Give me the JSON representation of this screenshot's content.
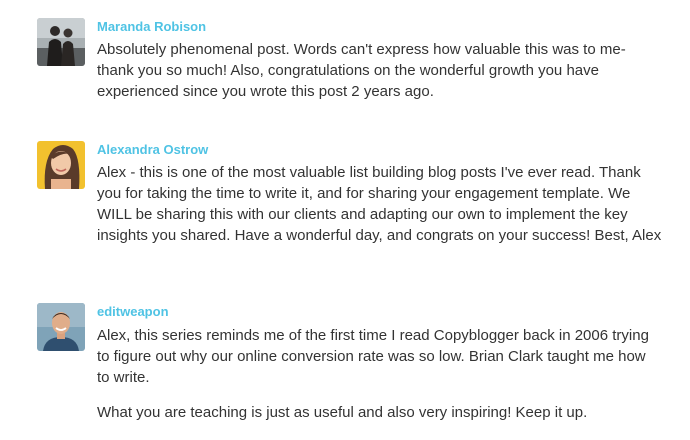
{
  "comments": [
    {
      "author": "Maranda Robison",
      "avatar_icon": "couple-photo-avatar",
      "paragraphs": [
        "Absolutely phenomenal post. Words can't express how valuable this was to me- thank you so much! Also, congratulations on the wonderful growth you have experienced since you wrote this post 2 years ago."
      ]
    },
    {
      "author": "Alexandra Ostrow",
      "avatar_icon": "woman-portrait-avatar",
      "paragraphs": [
        "Alex - this is one of the most valuable list building blog posts I've ever read. Thank you for taking the time to write it, and for sharing your engagement template. We WILL be sharing this with our clients and adapting our own to implement the key insights you shared. Have a wonderful day, and congrats on your success! Best, Alex"
      ]
    },
    {
      "author": "editweapon",
      "avatar_icon": "man-portrait-avatar",
      "paragraphs": [
        "Alex, this series reminds me of the first time I read Copyblogger back in 2006 trying to figure out why our online conversion rate was so low. Brian Clark taught me how to write.",
        "What you are teaching is just as useful and also very inspiring! Keep it up."
      ]
    }
  ],
  "colors": {
    "author_link": "#4fc3e4",
    "body_text": "#333333",
    "background": "#ffffff"
  }
}
